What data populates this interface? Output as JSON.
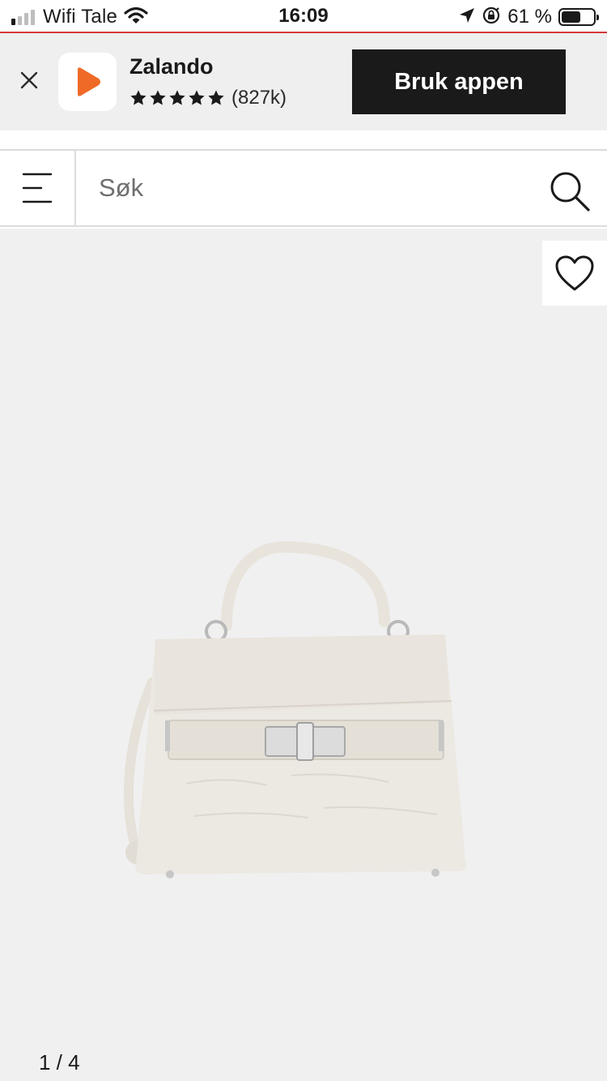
{
  "status_bar": {
    "carrier": "Wifi Tale",
    "time": "16:09",
    "battery_percent": "61 %",
    "battery_level": 0.61,
    "signal_bars_active": 1,
    "icons": [
      "signal-icon",
      "wifi-icon",
      "location-icon",
      "rotation-lock-icon",
      "battery-icon"
    ]
  },
  "app_banner": {
    "app_name": "Zalando",
    "rating_stars": 5,
    "rating_count": "(827k)",
    "open_button_label": "Bruk appen",
    "brand_color": "#ef6a26"
  },
  "search": {
    "placeholder": "Søk",
    "value": ""
  },
  "product": {
    "image_alt_icon": "handbag-icon",
    "page_indicator": "1 / 4"
  },
  "colors": {
    "banner_bg": "#efefef",
    "button_bg": "#1a1a1a",
    "gallery_bg": "#f0f0f0",
    "status_line": "#d43a3a"
  }
}
